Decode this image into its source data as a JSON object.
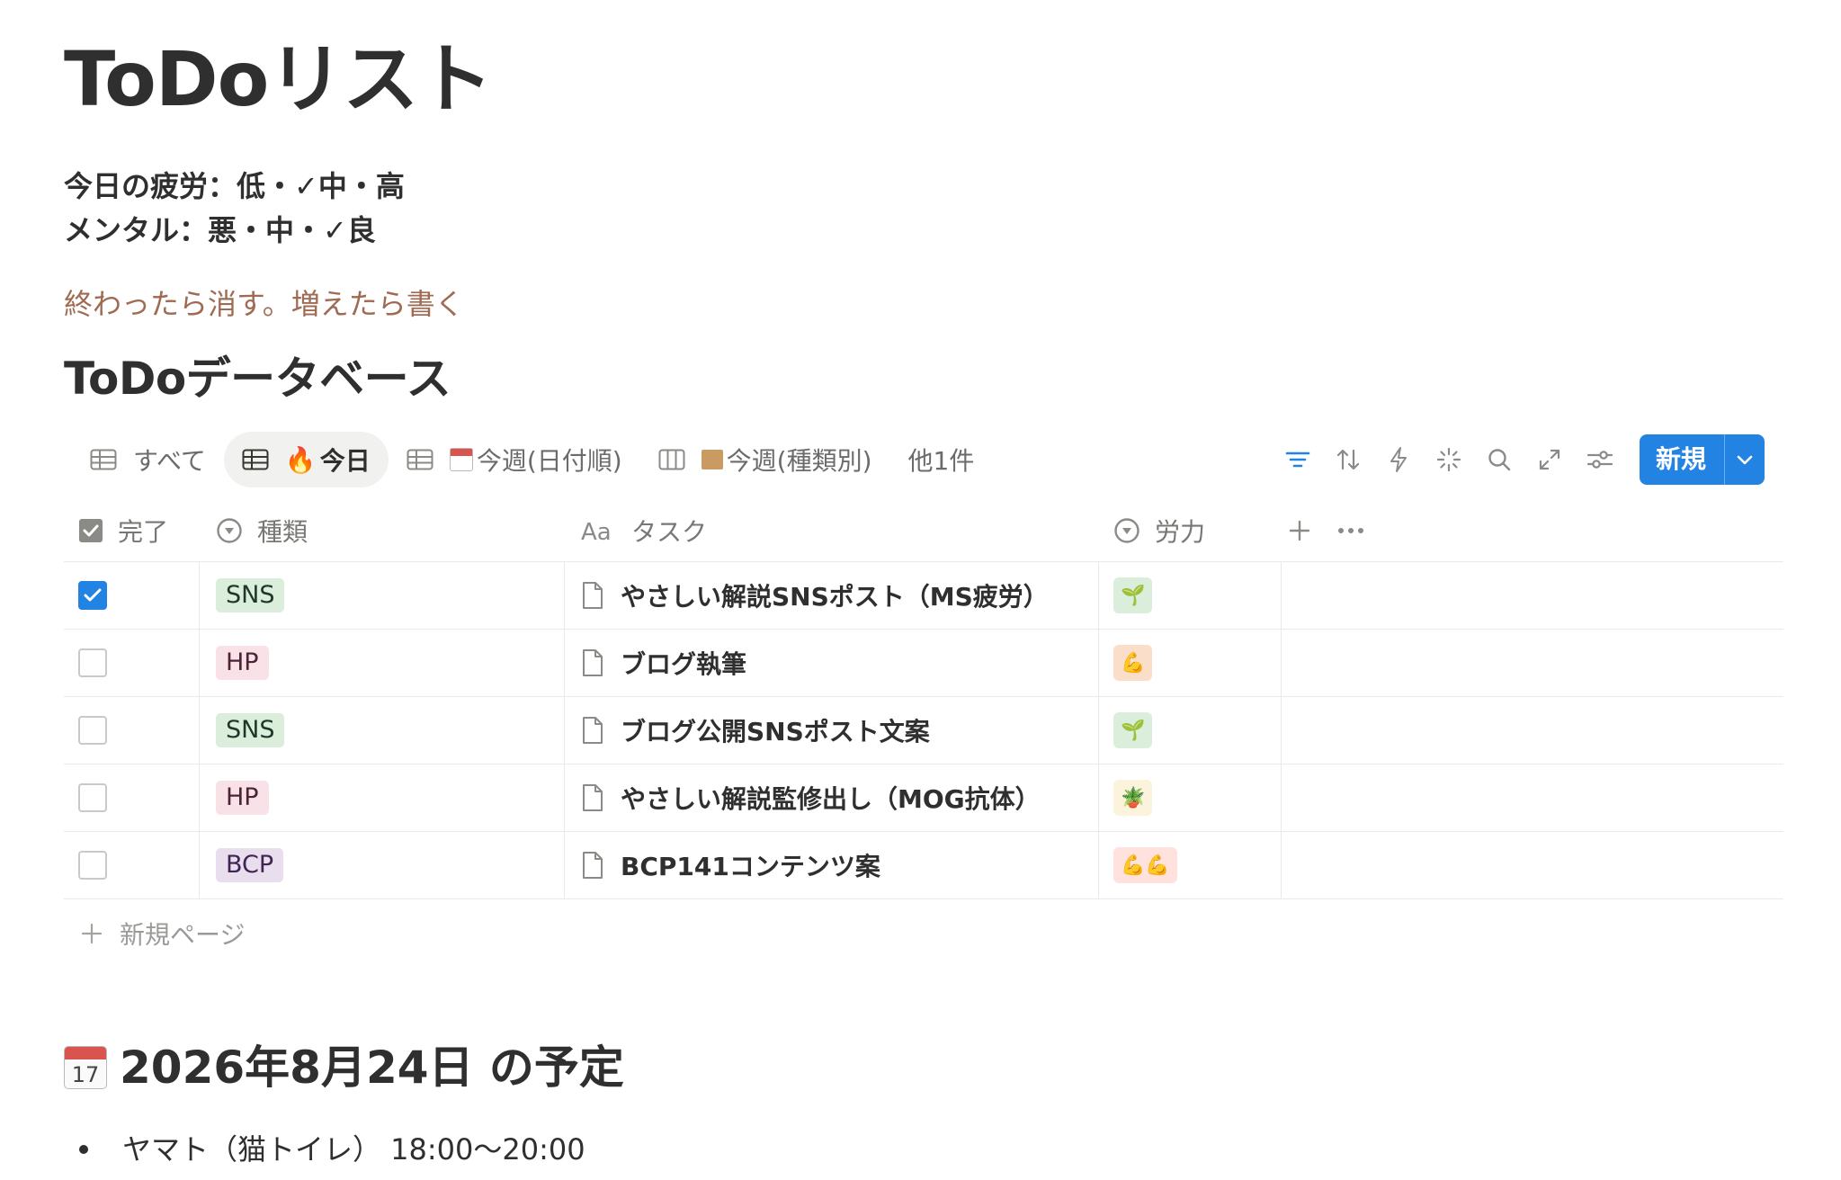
{
  "page": {
    "title": "ToDoリスト",
    "fatigue_line": "今日の疲労：低・✓中・高",
    "mental_line": "メンタル：悪・中・✓良",
    "note": "終わったら消す。増えたら書く"
  },
  "database": {
    "title": "ToDoデータベース",
    "views": [
      {
        "label": "すべて",
        "icon": "table-icon"
      },
      {
        "label": "今日",
        "prefix": "🔥",
        "icon": "table-icon",
        "active": true
      },
      {
        "label": "今週(日付順)",
        "prefix": "calendar",
        "icon": "table-icon"
      },
      {
        "label": "今週(種類別)",
        "prefix": "box",
        "icon": "board-icon"
      }
    ],
    "more_views": "他1件",
    "toolbar": {
      "icons": [
        "filter-icon",
        "sort-icon",
        "automation-icon",
        "ai-icon",
        "search-icon",
        "expand-icon",
        "settings-icon"
      ],
      "new_label": "新規",
      "accent": "#2383e2"
    },
    "columns": {
      "done": "完了",
      "kind": "種類",
      "task": "タスク",
      "effort": "労力"
    },
    "rows": [
      {
        "done": true,
        "kind": "SNS",
        "kind_color": "green",
        "task": "やさしい解説SNSポスト（MS疲労）",
        "effort": "🌱",
        "effort_color": "green"
      },
      {
        "done": false,
        "kind": "HP",
        "kind_color": "pink",
        "task": "ブログ執筆",
        "effort": "💪",
        "effort_color": "orange"
      },
      {
        "done": false,
        "kind": "SNS",
        "kind_color": "green",
        "task": "ブログ公開SNSポスト文案",
        "effort": "🌱",
        "effort_color": "green"
      },
      {
        "done": false,
        "kind": "HP",
        "kind_color": "pink",
        "task": "やさしい解説監修出し（MOG抗体）",
        "effort": "🪴",
        "effort_color": "yellow"
      },
      {
        "done": false,
        "kind": "BCP",
        "kind_color": "purple",
        "task": "BCP141コンテンツ案",
        "effort": "💪💪",
        "effort_color": "red"
      }
    ],
    "new_page": "新規ページ"
  },
  "schedule": {
    "calendar_day": "17",
    "heading": "2026年8月24日 の予定",
    "items": [
      "ヤマト（猫トイレ） 18:00〜20:00"
    ]
  }
}
